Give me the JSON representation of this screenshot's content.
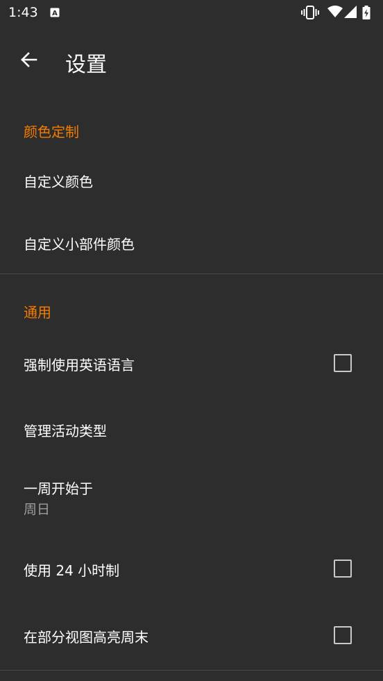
{
  "status_bar": {
    "time": "1:43",
    "icons": [
      "accessibility-a-icon",
      "vibrate-icon",
      "wifi-icon",
      "signal-icon",
      "battery-charging-icon"
    ]
  },
  "toolbar": {
    "title": "设置",
    "back_icon": "arrow-back-icon"
  },
  "sections": {
    "color": {
      "header": "颜色定制",
      "custom_colors": "自定义颜色",
      "custom_widget_colors": "自定义小部件颜色"
    },
    "general": {
      "header": "通用",
      "force_english": {
        "label": "强制使用英语语言",
        "checked": false
      },
      "manage_event_types": "管理活动类型",
      "week_start": {
        "label": "一周开始于",
        "value": "周日"
      },
      "use_24h": {
        "label": "使用 24 小时制",
        "checked": false
      },
      "highlight_weekends": {
        "label": "在部分视图高亮周末",
        "checked": false
      }
    }
  },
  "colors": {
    "background": "#2d2d2d",
    "accent": "#f57c00",
    "text_primary": "#ffffff",
    "text_secondary": "#9e9e9e"
  }
}
